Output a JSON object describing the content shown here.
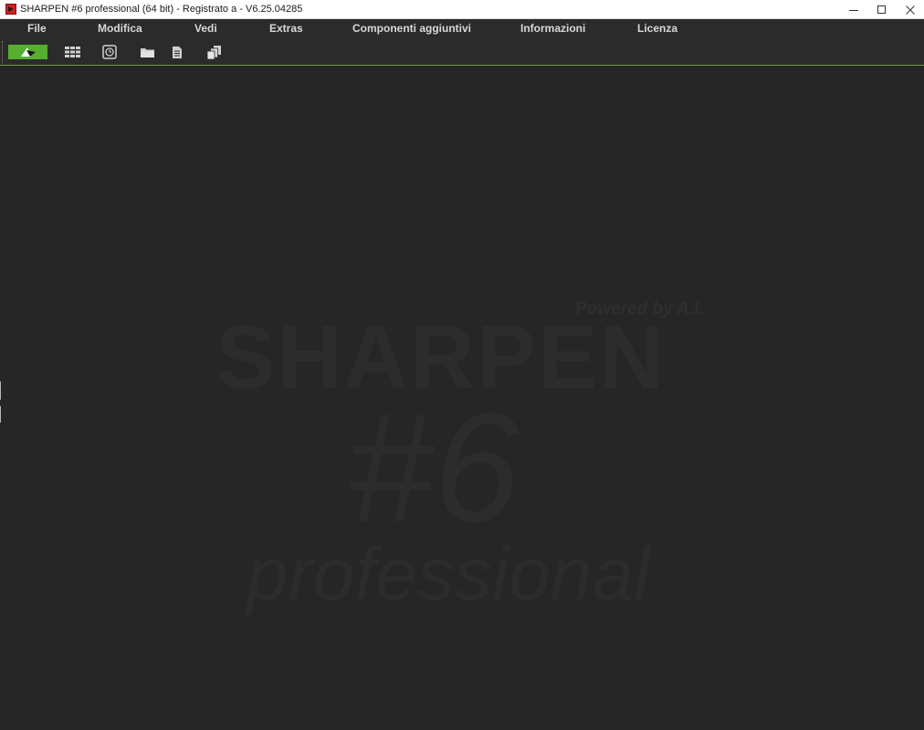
{
  "window": {
    "title": "SHARPEN #6 professional (64 bit) - Registrato a - V6.25.04285",
    "app_icon": "sharpen-app-icon",
    "controls": [
      "minimize-icon",
      "maximize-icon",
      "close-icon"
    ]
  },
  "menu": {
    "items": [
      {
        "label": "File"
      },
      {
        "label": "Modifica"
      },
      {
        "label": "Vedi"
      },
      {
        "label": "Extras"
      },
      {
        "label": "Componenti aggiuntivi"
      },
      {
        "label": "Informazioni"
      },
      {
        "label": "Licenza"
      }
    ]
  },
  "toolbar": {
    "buttons": [
      {
        "icon": "sharpen-logo-icon",
        "active": true
      },
      {
        "icon": "grid-view-icon",
        "active": false
      },
      {
        "icon": "history-icon",
        "active": false
      },
      {
        "icon": "folder-icon",
        "active": false
      },
      {
        "icon": "document-icon",
        "active": false
      },
      {
        "icon": "copies-icon",
        "active": false
      }
    ],
    "accent_color": "#55b030"
  },
  "watermark": {
    "powered": "Powered by A.I.",
    "name": "SHARPEN",
    "number": "#6",
    "edition": "professional"
  },
  "colors": {
    "background": "#262626",
    "menubar": "#2b2b2b",
    "accent": "#55b030"
  }
}
